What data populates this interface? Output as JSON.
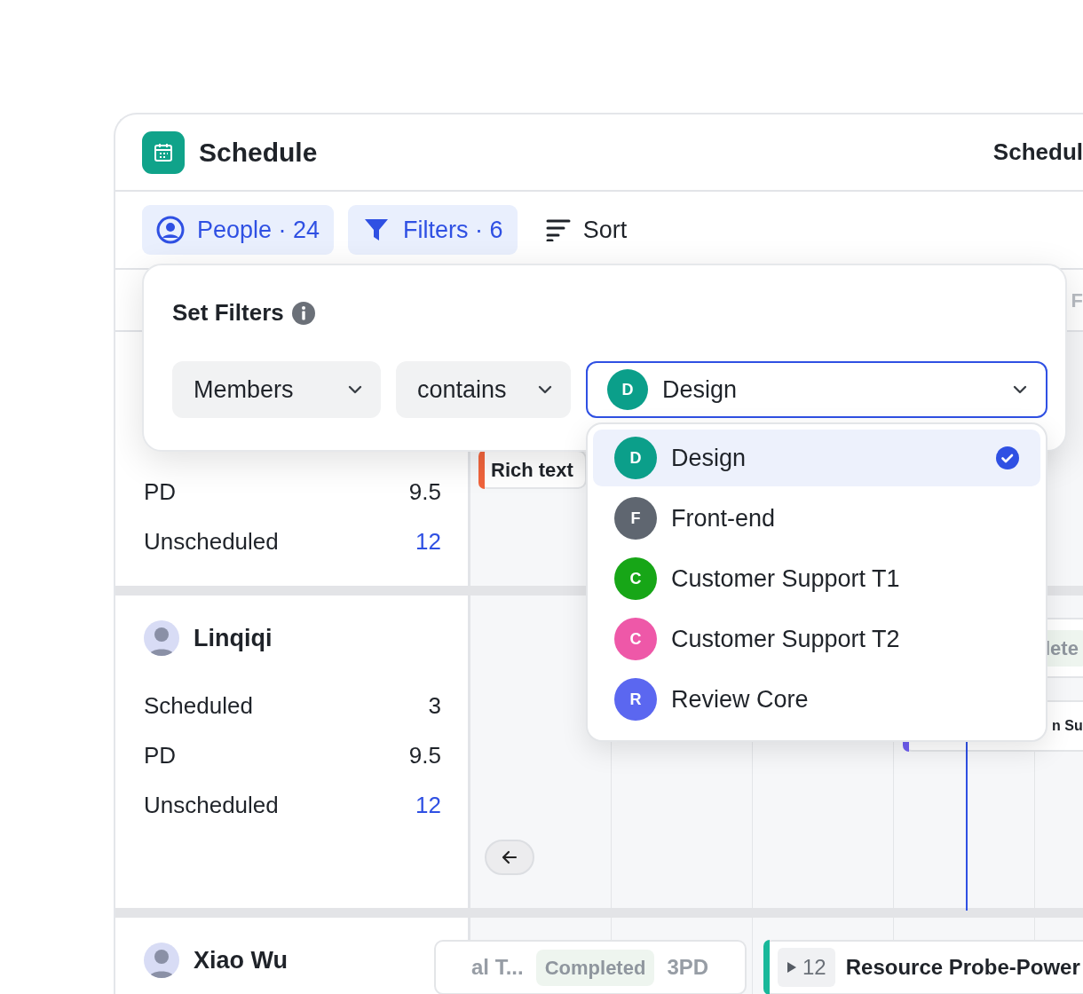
{
  "app": {
    "title": "Schedule",
    "header_right": "Schedul"
  },
  "toolbar": [
    {
      "kind": "people",
      "label": "People · 24",
      "active": true
    },
    {
      "kind": "filter",
      "label": "Filters · 6",
      "active": true
    },
    {
      "kind": "sort",
      "label": "Sort",
      "active": false
    }
  ],
  "timeline_header": {
    "day_label": "F"
  },
  "people": [
    {
      "stats": [
        {
          "label": "PD",
          "value": "9.5",
          "kind": "plain"
        },
        {
          "label": "Unscheduled",
          "value": "12",
          "kind": "link"
        }
      ],
      "tasks": [
        {
          "kind": "task",
          "title": "Rich text",
          "color": "#f0643c"
        }
      ]
    },
    {
      "name": "Linqiqi",
      "stats": [
        {
          "label": "Scheduled",
          "value": "3",
          "kind": "plain"
        },
        {
          "label": "PD",
          "value": "9.5",
          "kind": "plain"
        },
        {
          "label": "Unscheduled",
          "value": "12",
          "kind": "link"
        }
      ],
      "tasks": [
        {
          "kind": "status",
          "status": "lete"
        },
        {
          "kind": "task",
          "title": "n Su",
          "color": "#6d5cf0"
        }
      ]
    },
    {
      "name": "Xiao Wu",
      "tasks": [
        {
          "kind": "done",
          "title": "al T...",
          "status": "Completed",
          "estimate": "3PD"
        },
        {
          "kind": "group",
          "count": "12",
          "title": "Resource Probe-Power",
          "color": "#19b89a"
        }
      ]
    }
  ],
  "filter_popup": {
    "title": "Set Filters",
    "field": "Members",
    "operator": "contains",
    "value": {
      "initial": "D",
      "label": "Design",
      "color": "#0b9f8a"
    },
    "options": [
      {
        "initial": "D",
        "label": "Design",
        "color": "#0b9f8a",
        "selected": true
      },
      {
        "initial": "F",
        "label": "Front-end",
        "color": "#5f6670",
        "selected": false
      },
      {
        "initial": "C",
        "label": "Customer Support T1",
        "color": "#17a617",
        "selected": false
      },
      {
        "initial": "C",
        "label": "Customer Support T2",
        "color": "#ee58a8",
        "selected": false
      },
      {
        "initial": "R",
        "label": "Review Core",
        "color": "#5b67f0",
        "selected": false
      }
    ]
  }
}
